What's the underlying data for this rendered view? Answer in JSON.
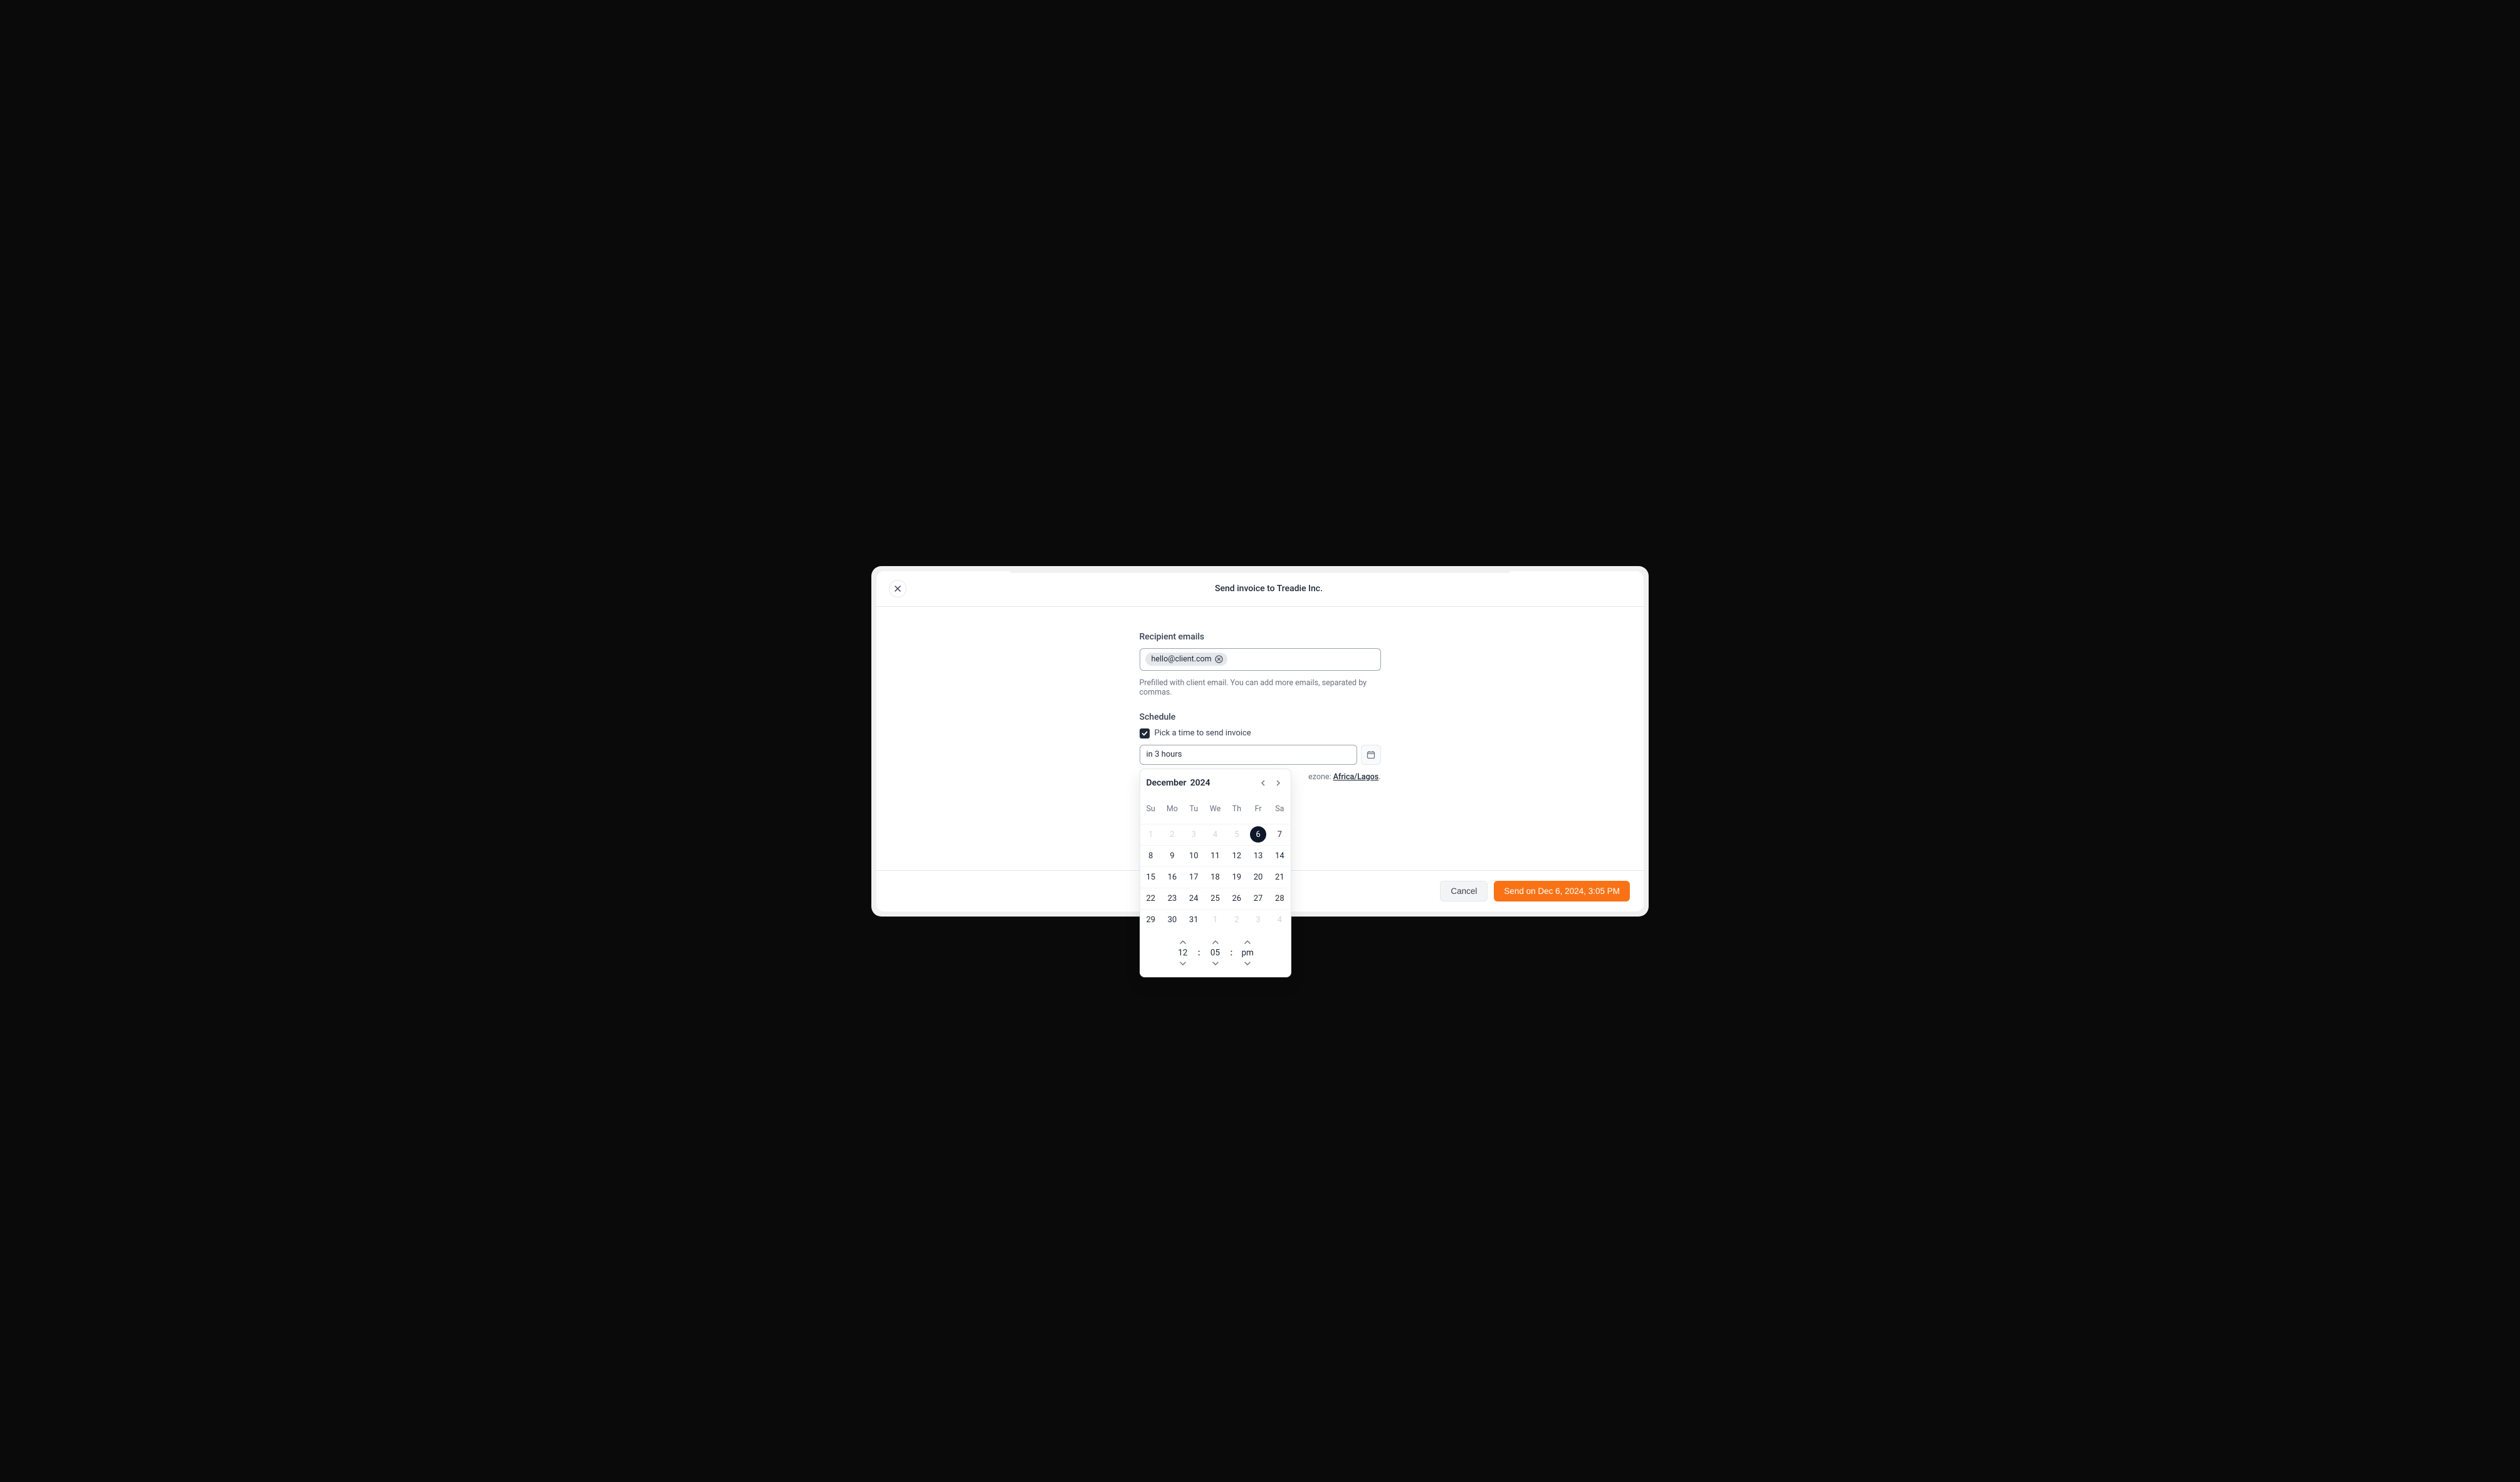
{
  "modal": {
    "title": "Send invoice to Treadie Inc."
  },
  "recipient": {
    "label": "Recipient emails",
    "chip_email": "hello@client.com",
    "help_text": "Prefilled with client email. You can add more emails, separated by commas."
  },
  "schedule": {
    "label": "Schedule",
    "checkbox_label": "Pick a time to send invoice",
    "input_value": "in 3 hours",
    "timezone_prefix": "ezone: ",
    "timezone_value": "Africa/Lagos"
  },
  "calendar": {
    "month": "December",
    "year": "2024",
    "weekdays": [
      "Su",
      "Mo",
      "Tu",
      "We",
      "Th",
      "Fr",
      "Sa"
    ],
    "days": [
      {
        "n": "1",
        "muted": true
      },
      {
        "n": "2",
        "muted": true
      },
      {
        "n": "3",
        "muted": true
      },
      {
        "n": "4",
        "muted": true
      },
      {
        "n": "5",
        "muted": true
      },
      {
        "n": "6",
        "selected": true
      },
      {
        "n": "7"
      },
      {
        "n": "8"
      },
      {
        "n": "9"
      },
      {
        "n": "10"
      },
      {
        "n": "11"
      },
      {
        "n": "12"
      },
      {
        "n": "13"
      },
      {
        "n": "14"
      },
      {
        "n": "15"
      },
      {
        "n": "16"
      },
      {
        "n": "17"
      },
      {
        "n": "18"
      },
      {
        "n": "19"
      },
      {
        "n": "20"
      },
      {
        "n": "21"
      },
      {
        "n": "22"
      },
      {
        "n": "23"
      },
      {
        "n": "24"
      },
      {
        "n": "25"
      },
      {
        "n": "26"
      },
      {
        "n": "27"
      },
      {
        "n": "28"
      },
      {
        "n": "29"
      },
      {
        "n": "30"
      },
      {
        "n": "31"
      },
      {
        "n": "1",
        "muted": true
      },
      {
        "n": "2",
        "muted": true
      },
      {
        "n": "3",
        "muted": true
      },
      {
        "n": "4",
        "muted": true
      }
    ],
    "time": {
      "hour": "12",
      "minute": "05",
      "ampm": "pm"
    }
  },
  "footer": {
    "cancel": "Cancel",
    "send": "Send on Dec 6, 2024, 3:05 PM"
  }
}
